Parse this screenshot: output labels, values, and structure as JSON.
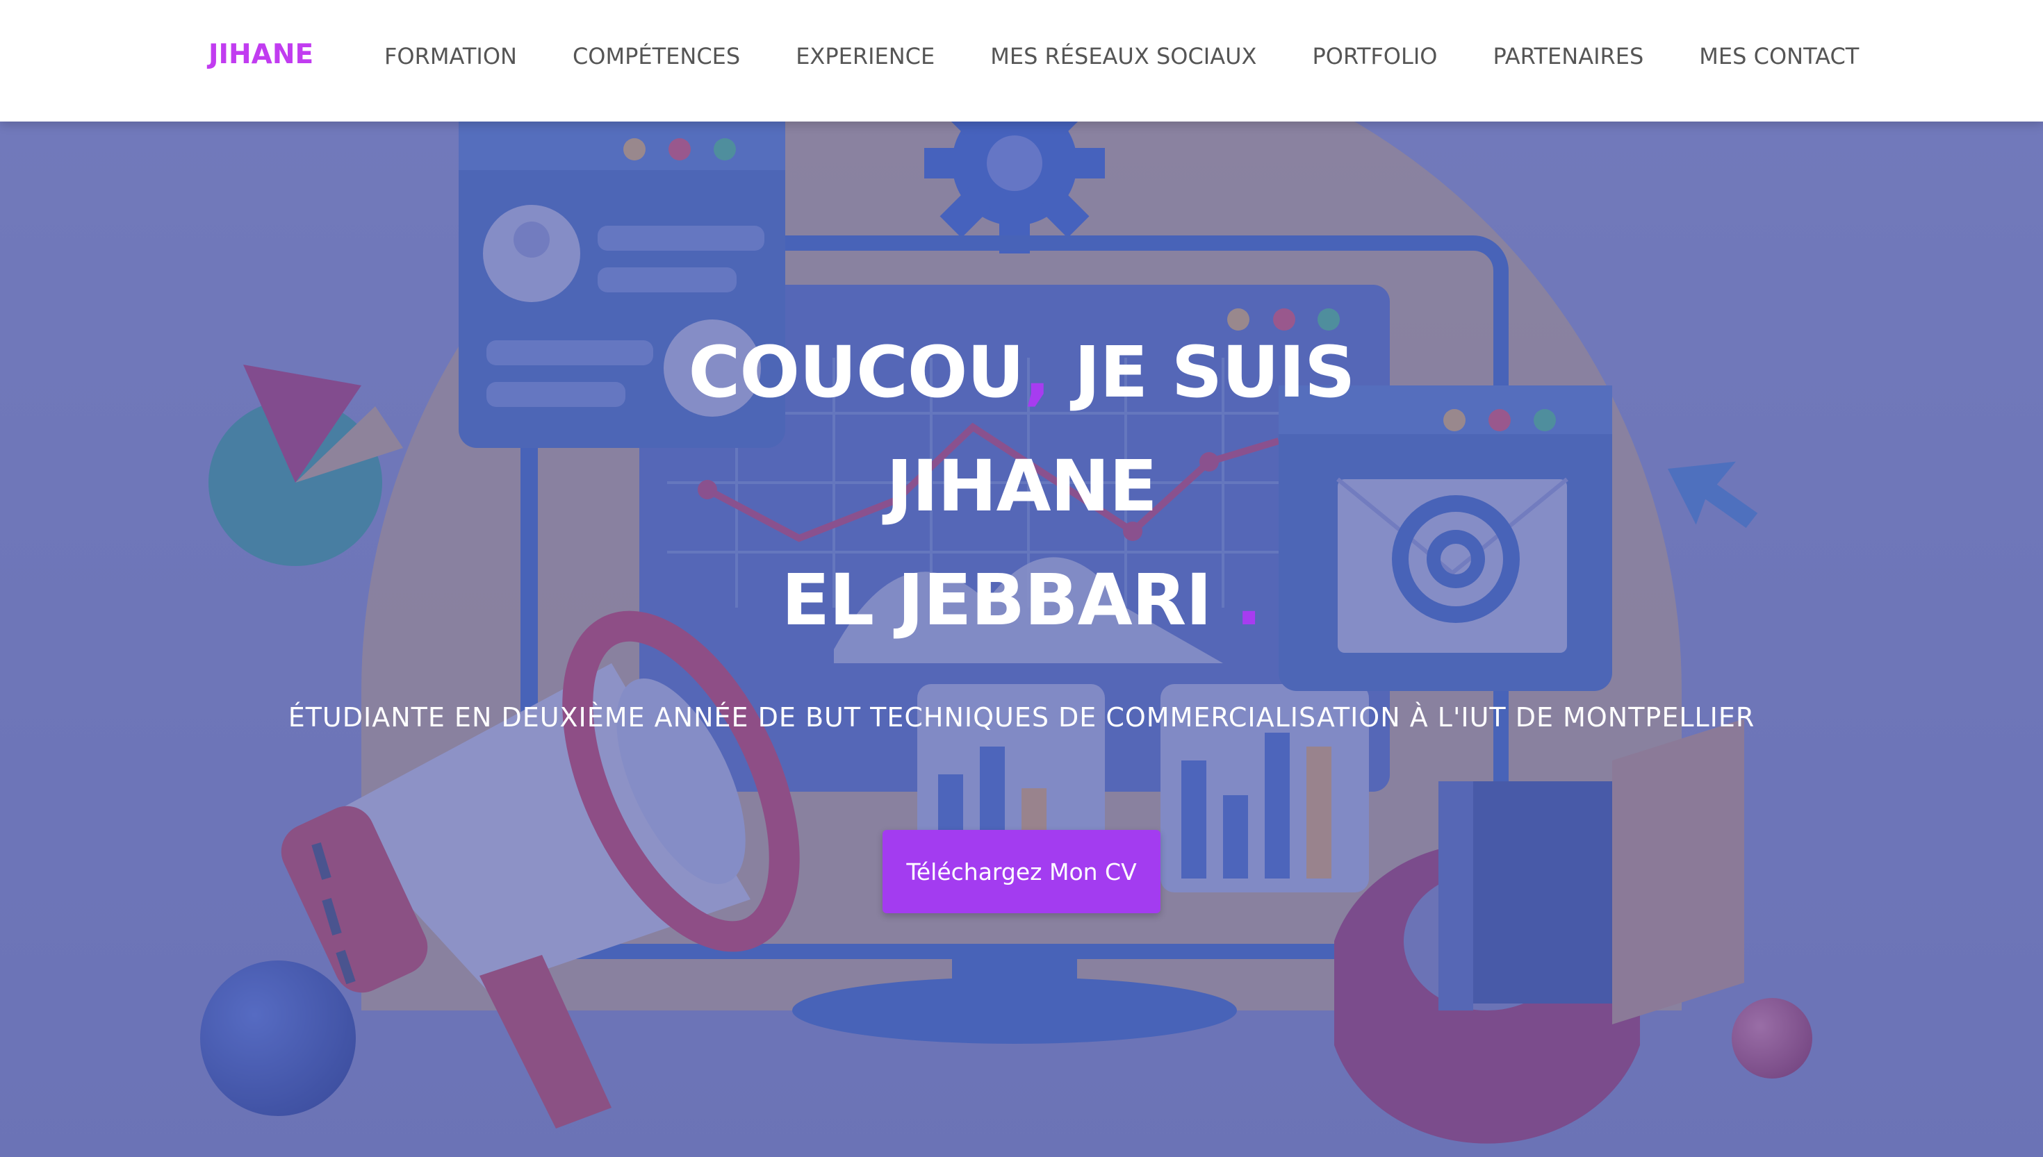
{
  "colors": {
    "accent": "#a73cf0",
    "brand_purple": "#c13cf0",
    "nav_text": "#555555",
    "button_bg": "#a33cf0",
    "overlay": "#5c64aa"
  },
  "navbar": {
    "brand": "JIHANE",
    "links": [
      {
        "label": "FORMATION"
      },
      {
        "label": "COMPÉTENCES"
      },
      {
        "label": "EXPERIENCE"
      },
      {
        "label": "MES RÉSEAUX SOCIAUX"
      },
      {
        "label": "PORTFOLIO"
      },
      {
        "label": "PARTENAIRES"
      },
      {
        "label": "MES CONTACT"
      }
    ]
  },
  "hero": {
    "headline_part1": "COUCOU",
    "headline_comma": ",",
    "headline_part2": " JE SUIS",
    "headline_line2": "JIHANE",
    "headline_line3": "EL JEBBARI",
    "headline_dot": ".",
    "subtitle": "ÉTUDIANTE EN DEUXIÈME ANNÉE DE BUT TECHNIQUES DE COMMERCIALISATION À L'IUT DE MONTPELLIER",
    "cta_label": "Téléchargez Mon CV",
    "illustration_icons": [
      "gear-icon",
      "profile-card-icon",
      "pie-chart-icon",
      "megaphone-icon",
      "monitor-icon",
      "line-chart-icon",
      "email-at-icon",
      "cursor-arrow-icon",
      "bar-chart-icon",
      "sphere-icon"
    ]
  }
}
